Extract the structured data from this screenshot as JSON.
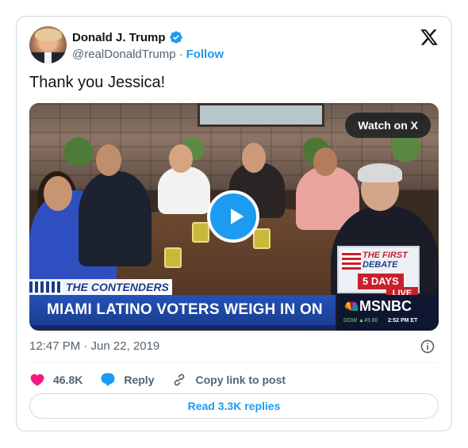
{
  "author": {
    "name": "Donald J. Trump",
    "handle": "@realDonaldTrump",
    "separator": "·",
    "follow_label": "Follow"
  },
  "tweet": {
    "text": "Thank you Jessica!",
    "timestamp": "12:47 PM · Jun 22, 2019"
  },
  "media": {
    "watch_label": "Watch on X",
    "overlay": {
      "contenders": "THE CONTENDERS",
      "headline": "MIAMI LATINO VOTERS WEIGH IN ON TRUMP",
      "debate_line1": "THE FIRST",
      "debate_line2": "DEBATE",
      "days": "5 DAYS",
      "live": "LIVE",
      "network": "MSNBC",
      "ticker": "DOW ▲49.80",
      "ticker_time": "2:52 PM ET"
    }
  },
  "actions": {
    "likes": "46.8K",
    "reply_label": "Reply",
    "copy_label": "Copy link to post"
  },
  "read_replies_label": "Read 3.3K replies",
  "colors": {
    "accent": "#1d9bf0",
    "like": "#f91880",
    "text": "#0f1419",
    "muted": "#536471",
    "border": "#cfd9de"
  },
  "icons": [
    "verified-badge-icon",
    "x-logo-icon",
    "play-icon",
    "info-icon",
    "heart-icon",
    "reply-bubble-icon",
    "link-icon"
  ]
}
